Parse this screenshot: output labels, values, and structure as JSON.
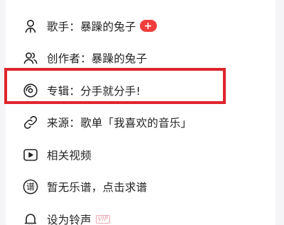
{
  "menu": {
    "items": [
      {
        "icon": "singer-icon",
        "label": "歌手：暴躁的兔子",
        "badge": "+"
      },
      {
        "icon": "creators-icon",
        "label": "创作者：暴躁的兔子"
      },
      {
        "icon": "album-icon",
        "label": "专辑：分手就分手!"
      },
      {
        "icon": "source-link-icon",
        "label": "来源：歌单「我喜欢的音乐」"
      },
      {
        "icon": "video-icon",
        "label": "相关视频"
      },
      {
        "icon": "sheet-music-icon",
        "label": "暂无乐谱，点击求谱",
        "icon_glyph": "谱"
      },
      {
        "icon": "bell-icon",
        "label": "设为铃声",
        "vip": "VIP"
      }
    ]
  },
  "colors": {
    "highlight": "#e0242b",
    "badge": "#f03c3c",
    "background": "#f5f5f7",
    "sheet": "#ffffff"
  }
}
